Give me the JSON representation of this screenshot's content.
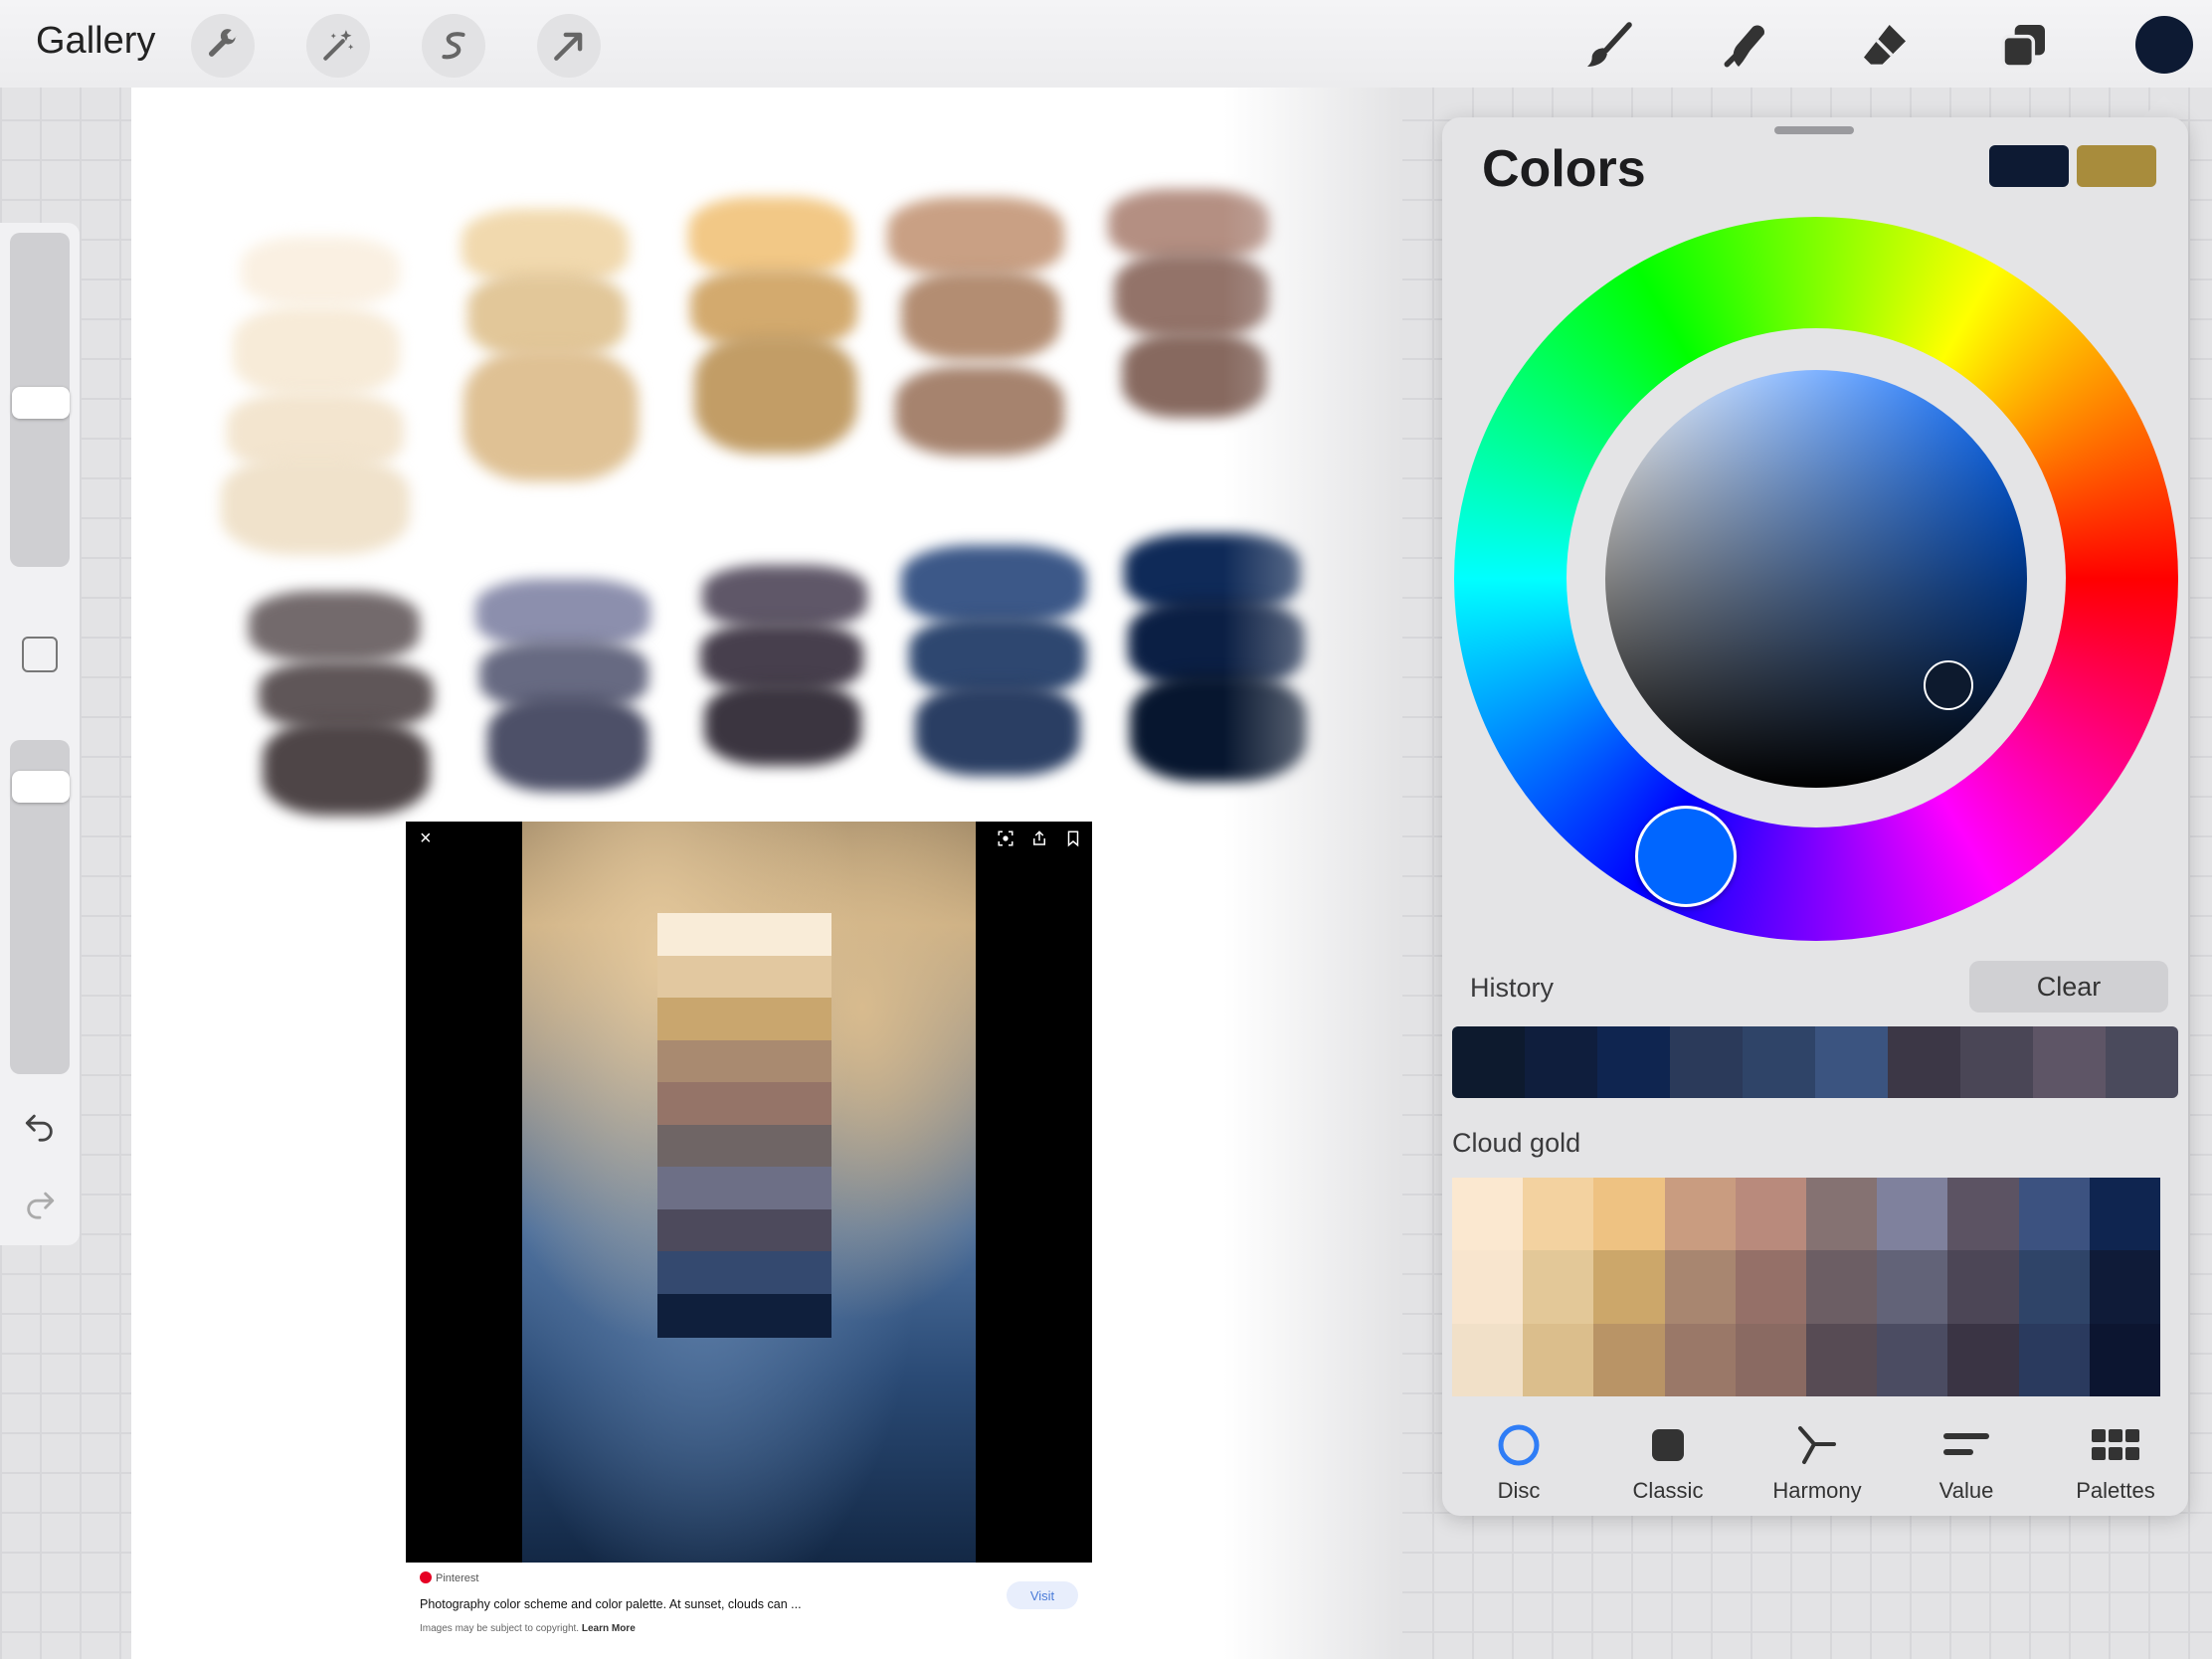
{
  "toolbar": {
    "gallery_label": "Gallery",
    "left_tools": [
      "wrench-icon",
      "magic-wand-icon",
      "selection-s-icon",
      "transform-arrow-icon"
    ],
    "right_tools": [
      "brush-icon",
      "smudge-icon",
      "eraser-icon",
      "layers-icon"
    ],
    "current_color": "#0d1a33"
  },
  "sidebar": {
    "brush_size_level": 0.49,
    "opacity_level": 0.2,
    "undo_icon": "undo-icon",
    "redo_icon": "redo-icon"
  },
  "canvas": {
    "paint_swatches_row1": [
      "#f7e8d2",
      "#e8cc9c",
      "#d6ac6f",
      "#b89378",
      "#93756a"
    ],
    "paint_swatches_row2": [
      "#5f5659",
      "#6c6f86",
      "#45404d",
      "#344a72",
      "#0d1d3d"
    ],
    "reference": {
      "source": "Pinterest",
      "caption": "Photography color scheme and color palette. At sunset, clouds can ...",
      "note_prefix": "Images may be subject to copyright.",
      "note_link": "Learn More",
      "visit_label": "Visit",
      "close_symbol": "×",
      "swatches": [
        "#f9ecd8",
        "#e2c8a0",
        "#c9a66e",
        "#a98a70",
        "#957468",
        "#6f6565",
        "#6d6f86",
        "#4d4a5c",
        "#34496f",
        "#0f1f3c"
      ]
    }
  },
  "colors_panel": {
    "title": "Colors",
    "primary_color": "#0d1a33",
    "secondary_color": "#a88c3c",
    "selected_hue_color": "#0066ff",
    "history_label": "History",
    "clear_label": "Clear",
    "history": [
      "#0d1a2e",
      "#0f1e3d",
      "#0f2550",
      "#2b3a5a",
      "#2f4468",
      "#3b5480",
      "#3c3746",
      "#4a4656",
      "#5e5566",
      "#4a4a5c"
    ],
    "palette_name": "Cloud gold",
    "palette": [
      [
        "#fbe8d0",
        "#f3d2a0",
        "#eec282",
        "#c99c80",
        "#b98a7c",
        "#857272",
        "#7f819d",
        "#5c5363",
        "#3c5280",
        "#0f2550"
      ],
      [
        "#f8e5ce",
        "#e3c898",
        "#cca76a",
        "#a88670",
        "#957068",
        "#6c5e64",
        "#626378",
        "#4c4656",
        "#2f4468",
        "#0f1b38"
      ],
      [
        "#f1e0c8",
        "#dbbe8c",
        "#b99466",
        "#9a7868",
        "#8a6a62",
        "#574b54",
        "#4b4c62",
        "#3a3444",
        "#2a3a5e",
        "#0c1530"
      ]
    ],
    "tabs": [
      {
        "label": "Disc",
        "icon": "disc-icon"
      },
      {
        "label": "Classic",
        "icon": "classic-square-icon"
      },
      {
        "label": "Harmony",
        "icon": "harmony-icon"
      },
      {
        "label": "Value",
        "icon": "value-sliders-icon"
      },
      {
        "label": "Palettes",
        "icon": "palettes-grid-icon"
      }
    ],
    "active_tab": "Disc"
  }
}
